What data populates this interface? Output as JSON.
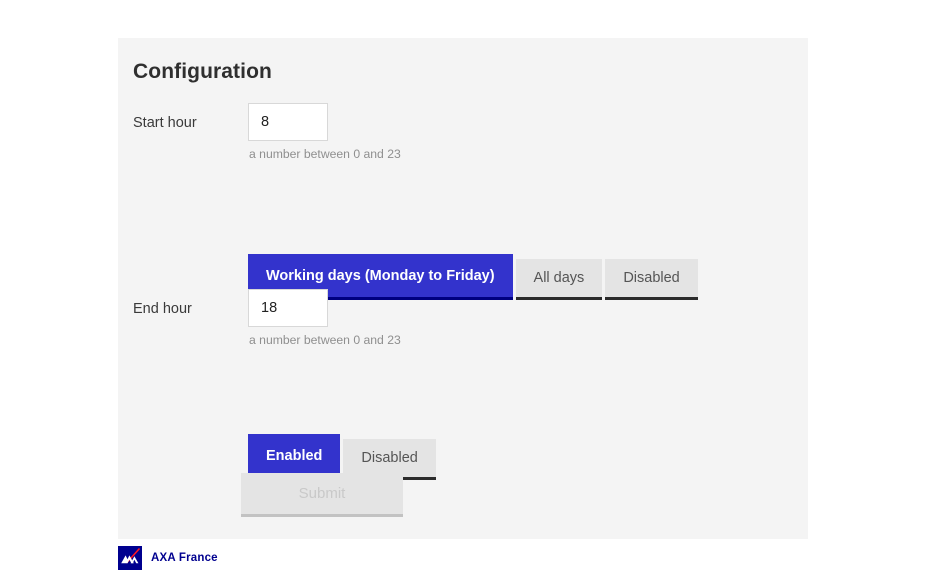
{
  "page": {
    "title": "Configuration",
    "card_bg": "#f4f4f4",
    "accent": "#3333cc",
    "accent_dark": "#000080"
  },
  "fields": {
    "start": {
      "label": "Start hour",
      "value": "8",
      "placeholder": "",
      "hint": "a number between 0 and 23"
    },
    "end": {
      "label": "End hour",
      "value": "18",
      "placeholder": "",
      "hint": "a number between 0 and 23"
    }
  },
  "day_mode_group": {
    "options": [
      {
        "label": "Working days (Monday to Friday)",
        "selected": true
      },
      {
        "label": "All days",
        "selected": false
      },
      {
        "label": "Disabled",
        "selected": false
      }
    ]
  },
  "enabled_group": {
    "options": [
      {
        "label": "Enabled",
        "selected": true
      },
      {
        "label": "Disabled",
        "selected": false
      }
    ]
  },
  "submit": {
    "label": "Submit",
    "disabled": true
  },
  "footer": {
    "logo_icon": "axa-logo-icon",
    "label": "AXA France",
    "logo_bg": "#00008f",
    "logo_slash": "#ff1721",
    "text_color": "#00008f"
  }
}
